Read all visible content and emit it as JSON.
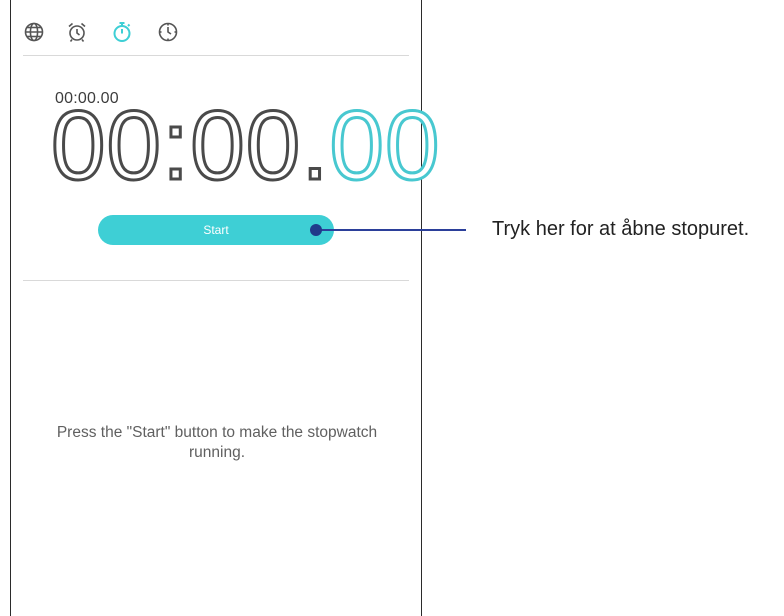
{
  "tabs": [
    {
      "name": "world-clock",
      "icon": "globe-icon",
      "active": false
    },
    {
      "name": "alarm",
      "icon": "alarm-clock-icon",
      "active": false
    },
    {
      "name": "stopwatch",
      "icon": "stopwatch-icon",
      "active": true
    },
    {
      "name": "timer",
      "icon": "timer-icon",
      "active": false
    }
  ],
  "colors": {
    "accent": "#3ecfd5",
    "inactive_icon": "#555555",
    "callout": "#203a8a"
  },
  "stopwatch": {
    "small_time": "00:00.00",
    "big_time_main": "00:00.",
    "big_time_hundredths": "00",
    "start_label": "Start",
    "hint": "Press the \"Start\" button to make the stopwatch running."
  },
  "callout": {
    "text": "Tryk her for at åbne stopuret."
  }
}
